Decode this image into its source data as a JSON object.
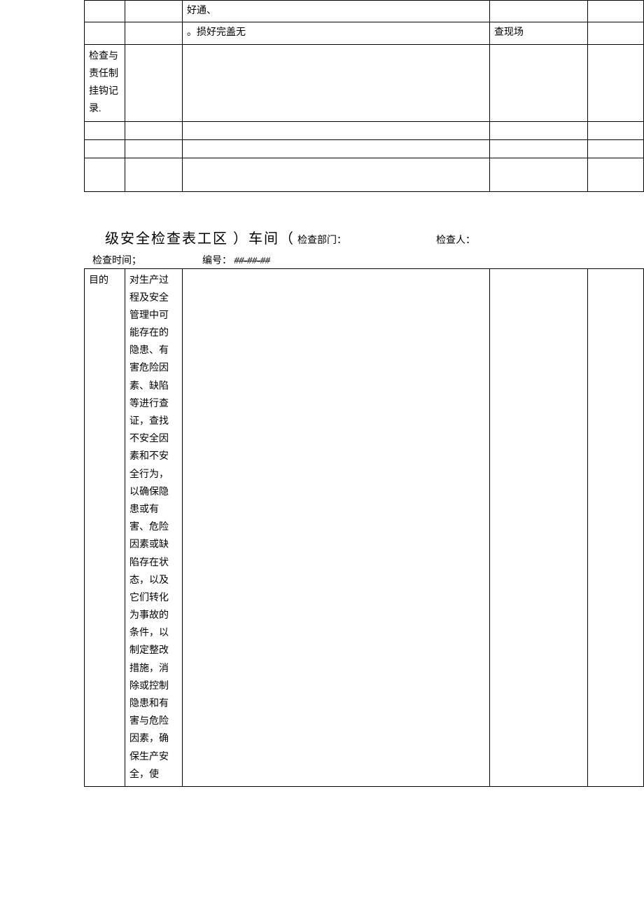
{
  "table1": {
    "rows": [
      {
        "c1": "",
        "c2": "",
        "c3": "好通、",
        "c4": "",
        "c5": ""
      },
      {
        "c1": "",
        "c2": "",
        "c3": "。损好完盖无",
        "c4": "查现场",
        "c5": ""
      },
      {
        "c1": "检查与责任制挂钩记录.",
        "c2": "",
        "c3": "",
        "c4": "",
        "c5": ""
      },
      {
        "c1": "",
        "c2": "",
        "c3": "",
        "c4": "",
        "c5": ""
      },
      {
        "c1": "",
        "c2": "",
        "c3": "",
        "c4": "",
        "c5": ""
      },
      {
        "c1": "",
        "c2": "",
        "c3": "",
        "c4": "",
        "c5": ""
      }
    ]
  },
  "header2": {
    "title": "级安全检查表工区  ）车间（",
    "dept_label": "检查部门：",
    "person_label": "检查人：",
    "time_label": "检查时间；",
    "no_label": "编号：",
    "no_value": "##-##-##"
  },
  "table2": {
    "rows": [
      {
        "c1": "目的",
        "c2": "对生产过程及安全管理中可能存在的隐患、有害危险因素、缺陷等进行查证，查找不安全因素和不安全行为，以确保隐患或有害、危险因素或缺陷存在状态，以及它们转化为事故的条件，以制定整改措施，消除或控制隐患和有害与危险因素，确保生产安全，使",
        "c3": "",
        "c4": "",
        "c5": ""
      }
    ]
  }
}
